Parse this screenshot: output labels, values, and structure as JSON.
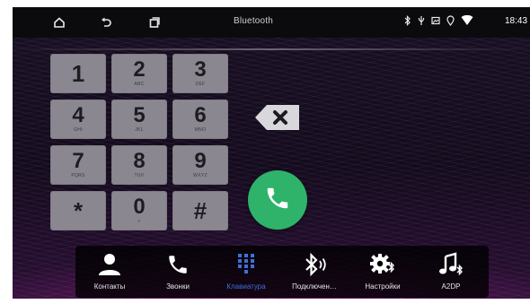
{
  "status_bar": {
    "title": "Bluetooth",
    "time": "18:43",
    "left_icons": [
      "home-icon",
      "back-icon",
      "recent-apps-icon"
    ],
    "right_icons": [
      "bluetooth-icon",
      "usb-icon",
      "image-icon",
      "location-icon",
      "wifi-icon"
    ]
  },
  "keypad": {
    "keys": [
      {
        "digit": "1",
        "letters": ""
      },
      {
        "digit": "2",
        "letters": "ABC"
      },
      {
        "digit": "3",
        "letters": "DEF"
      },
      {
        "digit": "4",
        "letters": "GHI"
      },
      {
        "digit": "5",
        "letters": "JKL"
      },
      {
        "digit": "6",
        "letters": "MNO"
      },
      {
        "digit": "7",
        "letters": "PQRS"
      },
      {
        "digit": "8",
        "letters": "TUV"
      },
      {
        "digit": "9",
        "letters": "WXYZ"
      },
      {
        "digit": "*",
        "letters": ""
      },
      {
        "digit": "0",
        "letters": "+"
      },
      {
        "digit": "#",
        "letters": ""
      }
    ]
  },
  "dialer": {
    "backspace_icon": "backspace-icon",
    "call_icon": "phone-icon",
    "call_color": "#2fb36a"
  },
  "dock": {
    "active_color": "#3f6fd8",
    "items": [
      {
        "label": "Контакты",
        "icon": "contacts-icon",
        "active": false
      },
      {
        "label": "Звонки",
        "icon": "phone-icon",
        "active": false
      },
      {
        "label": "Клавиатура",
        "icon": "dialpad-icon",
        "active": true
      },
      {
        "label": "Подключен…",
        "icon": "bluetooth-connect-icon",
        "active": false
      },
      {
        "label": "Настройки",
        "icon": "settings-icon",
        "active": false
      },
      {
        "label": "A2DP",
        "icon": "music-bluetooth-icon",
        "active": false
      }
    ]
  }
}
